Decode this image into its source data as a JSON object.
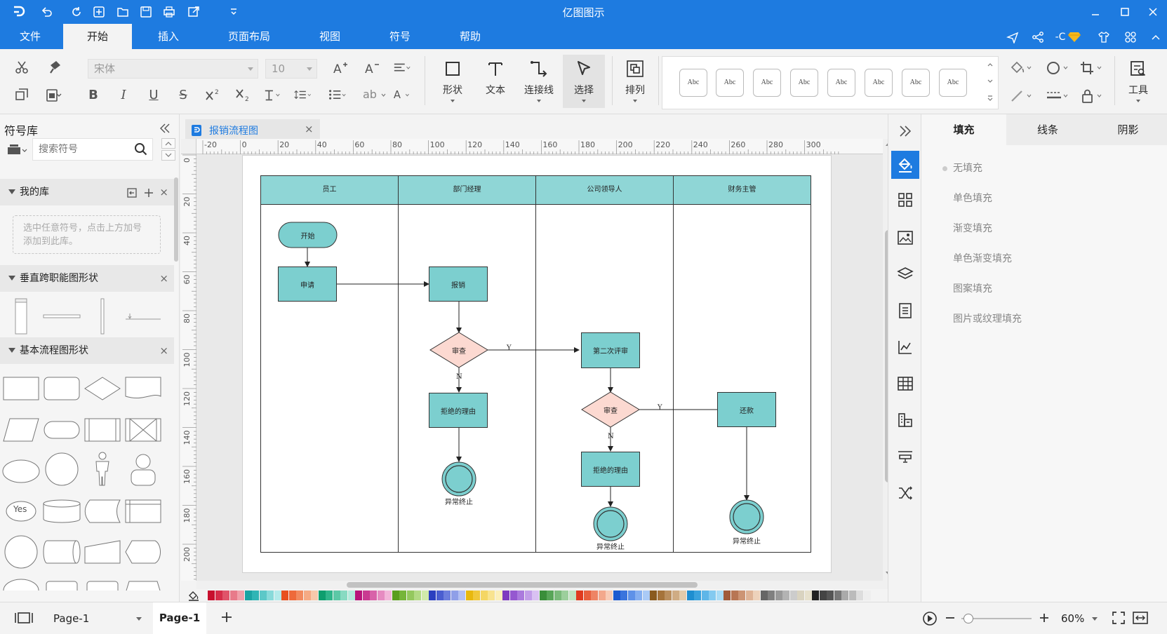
{
  "app": {
    "title": "亿图图示"
  },
  "menu": {
    "items": [
      "文件",
      "开始",
      "插入",
      "页面布局",
      "视图",
      "符号",
      "帮助"
    ],
    "active": "开始"
  },
  "account": {
    "label": "-C"
  },
  "ribbon": {
    "font_name": "宋体",
    "font_size": "10",
    "tools": {
      "shape": "形状",
      "text": "文本",
      "connector": "连接线",
      "select": "选择",
      "arrange": "排列",
      "tools": "工具"
    },
    "style_swatch_label": "Abc"
  },
  "symbol_library": {
    "title": "符号库",
    "search_placeholder": "搜索符号",
    "my_library": {
      "title": "我的库",
      "hint": "选中任意符号，点击上方加号添加到此库。"
    },
    "sections": [
      "垂直跨职能图形状",
      "基本流程图形状"
    ],
    "yes_shape": "Yes"
  },
  "document": {
    "tab_name": "报销流程图"
  },
  "ruler": {
    "h_labels": [
      "-20",
      "0",
      "20",
      "40",
      "60",
      "80",
      "100",
      "120",
      "140",
      "160",
      "180",
      "200",
      "220",
      "240",
      "260",
      "280",
      "300"
    ],
    "v_labels": [
      "0",
      "20",
      "40",
      "60",
      "80",
      "100",
      "120",
      "140",
      "160",
      "180",
      "200"
    ]
  },
  "diagram": {
    "lanes": [
      "员工",
      "部门经理",
      "公司领导人",
      "财务主管"
    ],
    "nodes": {
      "start": "开始",
      "apply": "申请",
      "reimburse": "报销",
      "review1": "审查",
      "reject1": "拒绝的理由",
      "second_review": "第二次评审",
      "review2": "审查",
      "reject2": "拒绝的理由",
      "pay": "还款",
      "end1": "异常终止",
      "end2": "异常终止",
      "end3": "异常终止"
    },
    "edge_labels": {
      "yes": "Y",
      "no": "N"
    }
  },
  "right_panel": {
    "tabs": [
      "填充",
      "线条",
      "阴影"
    ],
    "active_tab": "填充",
    "fill_options": [
      "无填充",
      "单色填充",
      "渐变填充",
      "单色渐变填充",
      "图案填充",
      "图片或纹理填充"
    ]
  },
  "status": {
    "page_selector": "Page-1",
    "page_tab": "Page-1",
    "zoom": "60%"
  },
  "colors": {
    "accent": "#1e7be0",
    "lane_header": "#8fd6d6",
    "process": "#7ccfcf",
    "decision": "#fcd9d1",
    "palette": [
      "#c8102e",
      "#d62e4a",
      "#e0546a",
      "#e87a8a",
      "#f0a0aa",
      "#1aa3a3",
      "#2fb5b5",
      "#5cc8c8",
      "#88dada",
      "#b3eaea",
      "#e8501e",
      "#ee6a3a",
      "#f28a5e",
      "#f5aa84",
      "#f8c9ab",
      "#0e9e6e",
      "#2fb58a",
      "#5cc8a6",
      "#88dac2",
      "#b3eadc",
      "#b8147a",
      "#c93a91",
      "#d862a9",
      "#e68bc1",
      "#f2b5d9",
      "#5a9e1e",
      "#76b53a",
      "#94c85e",
      "#b2da84",
      "#d0eaab",
      "#2a3fc0",
      "#4a5ed0",
      "#6c7edd",
      "#8f9fe8",
      "#b3c0f2",
      "#e8b80e",
      "#f0c83a",
      "#f4d664",
      "#f8e38f",
      "#fbefb9",
      "#7e3ac0",
      "#9558d0",
      "#ab7add",
      "#c29de8",
      "#d9c1f2",
      "#3a8e3a",
      "#58a558",
      "#7aba7a",
      "#9ccf9c",
      "#c0e2c0",
      "#e03a1e",
      "#e8603e",
      "#ee8464",
      "#f3a88c",
      "#f8cbb6",
      "#1e5ad0",
      "#3a74dd",
      "#5e91e8",
      "#84aef0",
      "#aacaf6",
      "#8a5a1e",
      "#a5733a",
      "#ba8f5e",
      "#cfac84",
      "#e2cbab",
      "#1e8ed0",
      "#3aa2dd",
      "#5eb6e8",
      "#84caf0",
      "#aadcf6",
      "#a05a3a",
      "#b87654",
      "#cc9474",
      "#deb396",
      "#edd2bb",
      "#666666",
      "#808080",
      "#999999",
      "#b3b3b3",
      "#cccccc",
      "#d9d3c0",
      "#e6e0cc",
      "#222222",
      "#444444",
      "#555555",
      "#777777",
      "#aaaaaa",
      "#bbbbbb",
      "#dddddd",
      "#eeeeee"
    ]
  }
}
